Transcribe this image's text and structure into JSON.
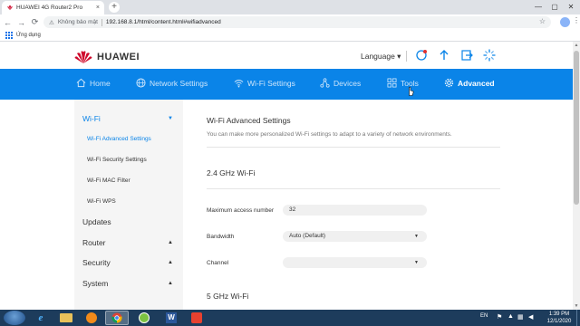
{
  "browser": {
    "tab_title": "HUAWEI 4G Router2 Pro",
    "tab_close": "×",
    "new_tab": "+",
    "back": "←",
    "forward": "→",
    "reload": "⟳",
    "security_text": "Không bảo mật",
    "url": "192.168.8.1/html/content.html#wifiadvanced",
    "star": "☆",
    "menu": "⋮",
    "bookmarks_label": "Ứng dụng",
    "window_controls": [
      "—",
      "▢",
      "✕"
    ]
  },
  "header": {
    "brand": "HUAWEI",
    "language": "Language ▾"
  },
  "nav": {
    "items": [
      {
        "label": "Home",
        "icon": "home-icon"
      },
      {
        "label": "Network Settings",
        "icon": "globe-icon"
      },
      {
        "label": "Wi-Fi Settings",
        "icon": "wifi-icon"
      },
      {
        "label": "Devices",
        "icon": "devices-icon"
      },
      {
        "label": "Tools",
        "icon": "tools-icon"
      },
      {
        "label": "Advanced",
        "icon": "gear-icon",
        "active": true
      }
    ]
  },
  "sidebar": {
    "wifi": "Wi-Fi",
    "wifi_sub": [
      "Wi-Fi Advanced Settings",
      "Wi-Fi Security Settings",
      "Wi-Fi MAC Filter",
      "Wi-Fi WPS"
    ],
    "updates": "Updates",
    "router": "Router",
    "security": "Security",
    "system": "System",
    "caret_down": "▼",
    "caret_up": "▲"
  },
  "content": {
    "title": "Wi-Fi Advanced Settings",
    "description": "You can make more personalized Wi-Fi settings to adapt to a variety of network environments.",
    "section_24": "2.4 GHz Wi-Fi",
    "max_access_label": "Maximum access number",
    "max_access_value": "32",
    "bandwidth_label": "Bandwidth",
    "bandwidth_value": "Auto (Default)",
    "channel_label": "Channel",
    "channel_value": "",
    "section_5": "5 GHz Wi-Fi"
  },
  "taskbar": {
    "language": "EN",
    "time": "1:39 PM",
    "date": "12/1/2020"
  },
  "colors": {
    "accent": "#0a84e8",
    "brand_red": "#cf0a2c",
    "taskbar": "#1d3c5c"
  }
}
